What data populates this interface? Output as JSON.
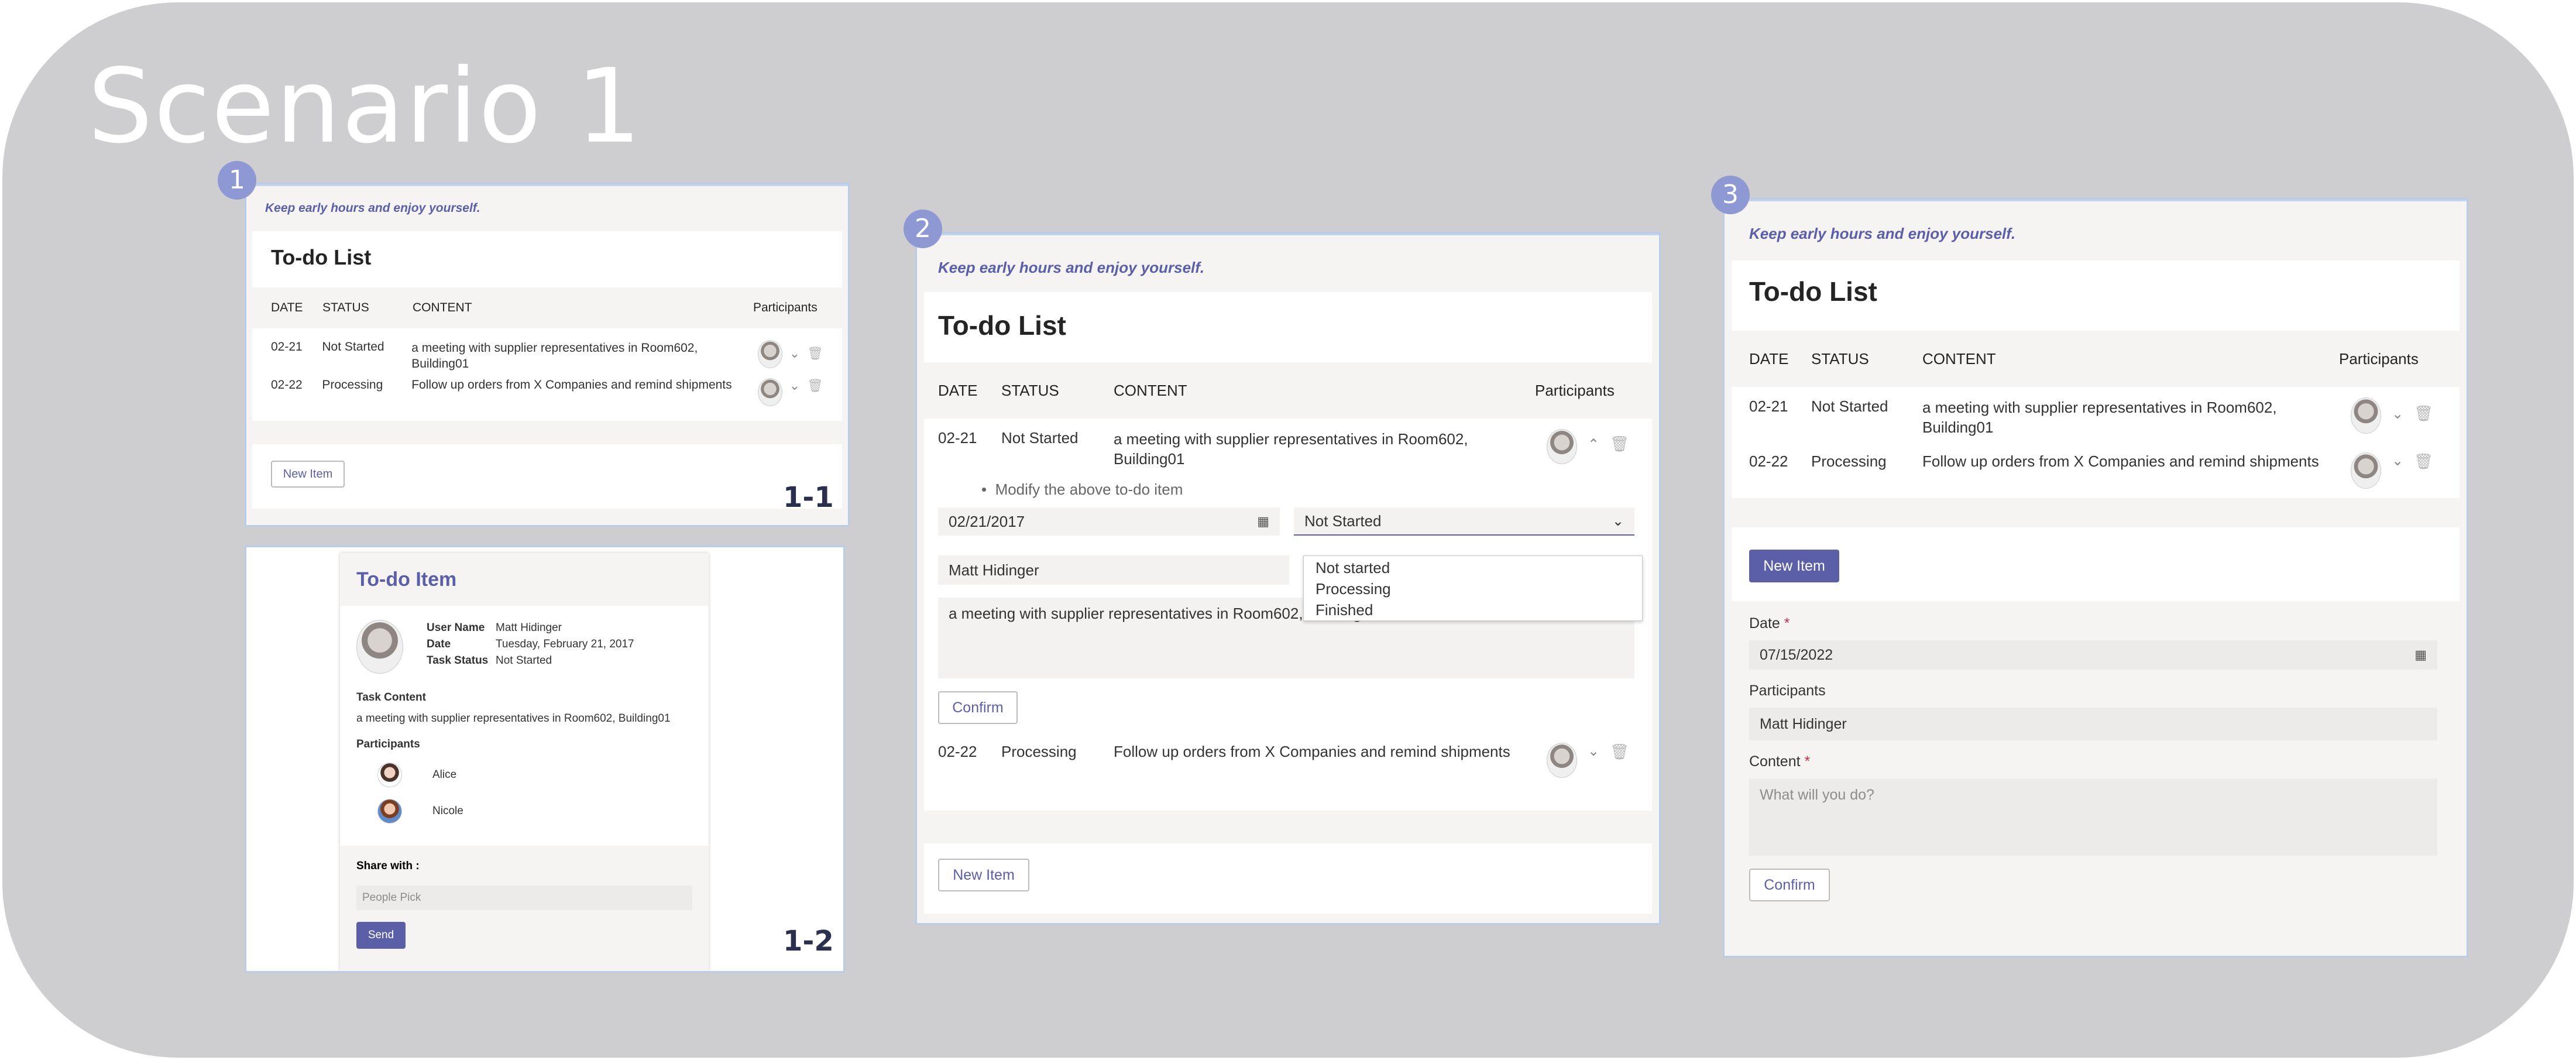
{
  "scenario": {
    "title": "Scenario 1"
  },
  "badges": [
    "1",
    "2",
    "3"
  ],
  "panel_ids": {
    "p11": "1-1",
    "p12": "1-2"
  },
  "todo": {
    "motto": "Keep early hours and enjoy yourself.",
    "title": "To-do List",
    "headers": {
      "date": "DATE",
      "status": "STATUS",
      "content": "CONTENT",
      "participants": "Participants"
    },
    "rows": [
      {
        "date": "02-21",
        "status": "Not Started",
        "content_line1": "a meeting with supplier representatives in Room602,",
        "content_line2": "Building01"
      },
      {
        "date": "02-22",
        "status": "Processing",
        "content_line1": "Follow up orders from X Companies and remind shipments",
        "content_line2": ""
      }
    ],
    "new_item": "New Item"
  },
  "detail": {
    "title": "To-do Item",
    "user_name_label": "User Name",
    "user_name": "Matt Hidinger",
    "date_label": "Date",
    "date": "Tuesday, February 21, 2017",
    "status_label": "Task Status",
    "status": "Not Started",
    "content_label": "Task Content",
    "content": "a meeting with supplier representatives in Room602, Building01",
    "participants_label": "Participants",
    "participants": [
      "Alice",
      "Nicole"
    ],
    "share_label": "Share with :",
    "share_placeholder": "People Pick",
    "send": "Send"
  },
  "edit": {
    "hint": "Modify the above to-do item",
    "date_value": "02/21/2017",
    "status_value": "Not Started",
    "options": [
      "Not started",
      "Processing",
      "Finished"
    ],
    "participant_value": "Matt Hidinger",
    "content_value": "a meeting with supplier representatives in Room602, Building01",
    "confirm": "Confirm"
  },
  "new_form": {
    "date_label": "Date",
    "required": "*",
    "date_value": "07/15/2022",
    "participants_label": "Participants",
    "participant_value": "Matt Hidinger",
    "content_label": "Content",
    "content_placeholder": "What will you do?",
    "confirm": "Confirm"
  },
  "icons": {
    "chevron": "chevron-down-icon",
    "trash": "trash-icon",
    "calendar": "calendar-icon"
  }
}
